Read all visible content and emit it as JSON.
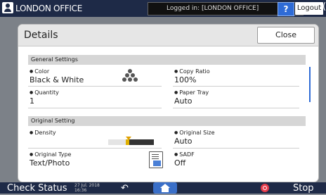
{
  "topbar": {
    "office": "LONDON OFFICE",
    "login_status": "Logged in: [LONDON OFFICE]",
    "help": "?",
    "logout": "Logout"
  },
  "dialog": {
    "title": "Details",
    "close": "Close",
    "sections": {
      "general": "General Settings",
      "original": "Original Setting"
    },
    "color": {
      "label": "Color",
      "value": "Black & White"
    },
    "copy_ratio": {
      "label": "Copy Ratio",
      "value": "100%"
    },
    "quantity": {
      "label": "Quantity",
      "value": "1"
    },
    "paper_tray": {
      "label": "Paper Tray",
      "value": "Auto"
    },
    "density": {
      "label": "Density",
      "level": 5,
      "steps": 13
    },
    "original_size": {
      "label": "Original Size",
      "value": "Auto"
    },
    "original_type": {
      "label": "Original Type",
      "value": "Text/Photo"
    },
    "sadf": {
      "label": "SADF",
      "value": "Off"
    }
  },
  "bottombar": {
    "check_status": "Check Status",
    "date": "27 Jul. 2018",
    "time": "16:36",
    "stop": "Stop"
  },
  "colors": {
    "topbar": "#1e2a47",
    "accent": "#2e6bd6",
    "stop": "#e53b4a"
  }
}
